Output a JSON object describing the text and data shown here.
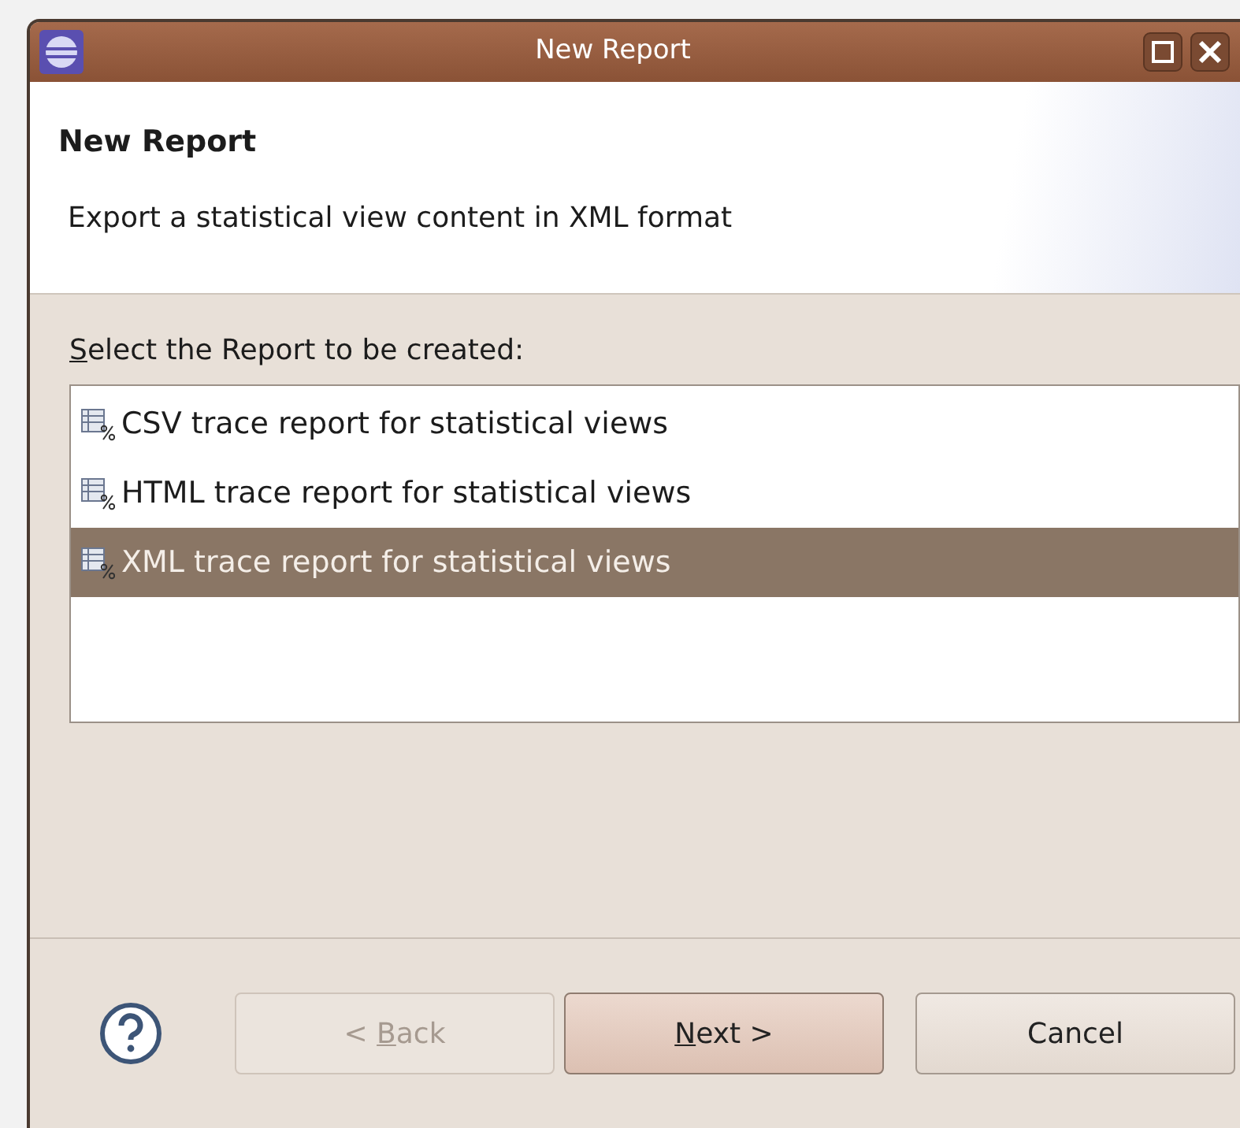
{
  "window": {
    "title": "New Report"
  },
  "header": {
    "title": "New Report",
    "description": "Export a statistical view content in XML format"
  },
  "list_label": {
    "key": "S",
    "after": "elect the Report to be created:"
  },
  "reports": [
    {
      "label": "CSV trace report for statistical views",
      "selected": false
    },
    {
      "label": "HTML trace report for statistical views",
      "selected": false
    },
    {
      "label": "XML trace report for statistical views",
      "selected": true
    }
  ],
  "buttons": [
    {
      "kind": "nav",
      "before": "< ",
      "key": "B",
      "after": "ack",
      "disabled": true,
      "default": false
    },
    {
      "kind": "nav",
      "key": "N",
      "after": "ext >",
      "disabled": false,
      "default": true
    },
    {
      "kind": "nav",
      "before": "Cancel",
      "disabled": false,
      "default": false
    }
  ]
}
